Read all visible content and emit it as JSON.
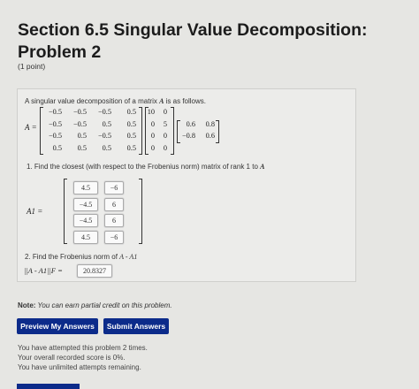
{
  "header": {
    "title": "Section 6.5 Singular Value Decomposition: Problem 2",
    "points": "(1 point)"
  },
  "problem": {
    "intro_text": "A singular value decomposition of a matrix ",
    "intro_symbol": "A",
    "intro_suffix": " is as follows.",
    "matrix_label": "A =",
    "U": [
      [
        "-0.5",
        "-0.5",
        "-0.5",
        "0.5"
      ],
      [
        "-0.5",
        "-0.5",
        "0.5",
        "0.5"
      ],
      [
        "-0.5",
        "0.5",
        "-0.5",
        "0.5"
      ],
      [
        "0.5",
        "0.5",
        "0.5",
        "0.5"
      ]
    ],
    "S": [
      [
        "10",
        "0"
      ],
      [
        "0",
        "5"
      ],
      [
        "0",
        "0"
      ],
      [
        "0",
        "0"
      ]
    ],
    "V": [
      [
        "0.6",
        "0.8"
      ],
      [
        "-0.8",
        "0.6"
      ]
    ],
    "q1_text": "1. Find the closest (with respect to the Frobenius norm) matrix of rank 1 to ",
    "q1_symbol": "A",
    "a1_label": "A1 =",
    "a1_inputs": [
      [
        "4.5",
        "-6"
      ],
      [
        "-4.5",
        "6"
      ],
      [
        "-4.5",
        "6"
      ],
      [
        "4.5",
        "-6"
      ]
    ],
    "q2_text": "2. Find the Frobenius norm of ",
    "q2_symbol": "A - A1",
    "norm_label": "||A - A1||F =",
    "norm_value": "20.8327"
  },
  "note": {
    "bold": "Note:",
    "text": " You can earn partial credit on this problem."
  },
  "buttons": {
    "preview": "Preview My Answers",
    "submit": "Submit Answers"
  },
  "status": [
    "You have attempted this problem 2 times.",
    "Your overall recorded score is 0%.",
    "You have unlimited attempts remaining."
  ],
  "colors": {
    "button": "#0c2b8a"
  }
}
